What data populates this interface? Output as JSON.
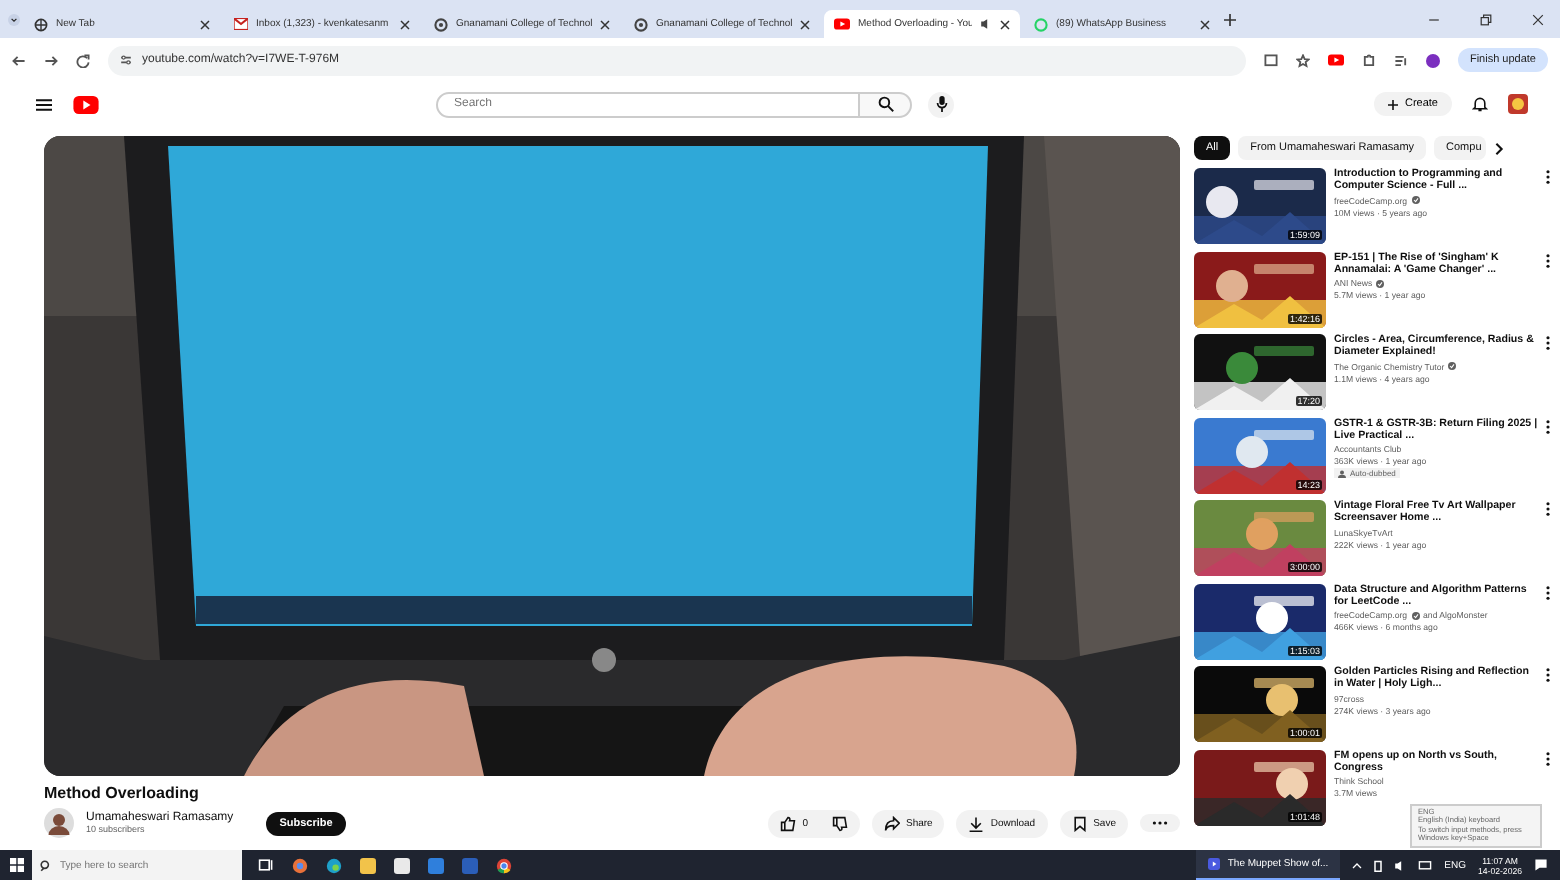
{
  "tabs": [
    {
      "label": "New Tab",
      "selected": false
    },
    {
      "label": "Inbox (1,323) - kvenkatesanm",
      "selected": false
    },
    {
      "label": "Gnanamani College of Technol",
      "selected": false
    },
    {
      "label": "Gnanamani College of Technol",
      "selected": false
    },
    {
      "label": "Method Overloading - You",
      "selected": true
    },
    {
      "label": "(89) WhatsApp Business",
      "selected": false
    }
  ],
  "address": {
    "url": "youtube.com/watch?v=I7WE-T-976M",
    "update_button": "Finish update"
  },
  "header": {
    "search_placeholder": "Search",
    "create_button": "Create"
  },
  "video": {
    "title": "Method Overloading",
    "channel": "Umamaheswari Ramasamy",
    "subscribers": "10 subscribers",
    "subscribe_button": "Subscribe",
    "likes": "0",
    "share": "Share",
    "download": "Download",
    "save": "Save"
  },
  "chips": [
    {
      "label": "All",
      "selected": true
    },
    {
      "label": "From Umamaheswari Ramasamy",
      "selected": false
    },
    {
      "label": "Compu",
      "selected": false
    }
  ],
  "related": [
    {
      "title": "Introduction to Programming and Computer Science - Full ...",
      "channel": "freeCodeCamp.org",
      "verified": true,
      "meta": "10M views · 5 years ago",
      "duration": "1:59:09"
    },
    {
      "title": "EP-151 | The Rise of 'Singham' K Annamalai: A 'Game Changer' ...",
      "channel": "ANI News",
      "verified": true,
      "meta": "5.7M views · 1 year ago",
      "duration": "1:42:16"
    },
    {
      "title": "Circles - Area, Circumference, Radius & Diameter Explained!",
      "channel": "The Organic Chemistry Tutor",
      "verified": true,
      "meta": "1.1M views · 4 years ago",
      "duration": "17:20"
    },
    {
      "title": "GSTR-1 & GSTR-3B: Return Filing 2025 | Live Practical ...",
      "channel": "Accountants Club",
      "verified": false,
      "meta": "363K views · 1 year ago",
      "duration": "14:23",
      "badge": "Auto-dubbed"
    },
    {
      "title": "Vintage Floral Free Tv Art Wallpaper Screensaver Home ...",
      "channel": "LunaSkyeTvArt",
      "verified": false,
      "meta": "222K views · 1 year ago",
      "duration": "3:00:00"
    },
    {
      "title": "Data Structure and Algorithm Patterns for LeetCode ...",
      "channel": "freeCodeCamp.org",
      "verified": true,
      "channel_suffix": "and AlgoMonster",
      "meta": "466K views · 6 months ago",
      "duration": "1:15:03"
    },
    {
      "title": "Golden Particles Rising and Reflection in Water | Holy Ligh...",
      "channel": "97cross",
      "verified": false,
      "meta": "274K views · 3 years ago",
      "duration": "1:00:01"
    },
    {
      "title": "FM opens up on North vs South, Congress",
      "channel": "Think School",
      "verified": false,
      "meta": "3.7M views",
      "duration": "1:01:48"
    }
  ],
  "ime_tooltip": {
    "title": "ENG",
    "subtitle": "English (India) keyboard",
    "hint": "To switch input methods, press Windows key+Space"
  },
  "taskbar": {
    "search_placeholder": "Type here to search",
    "running_app": "The Muppet Show of...",
    "language": "ENG",
    "time": "11:07 AM",
    "date": "14-02-2026"
  }
}
